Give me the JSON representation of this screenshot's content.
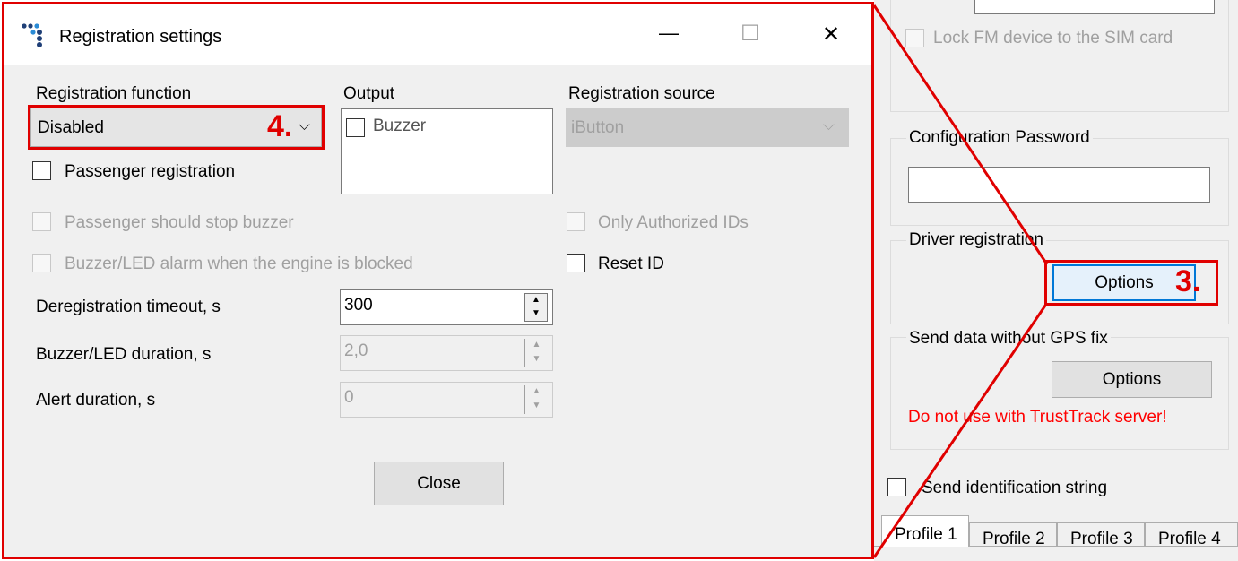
{
  "dialog": {
    "title": "Registration settings",
    "title_buttons": {
      "minimize": "—",
      "maximize": "☐",
      "close": "✕"
    },
    "registration_function": {
      "label": "Registration function",
      "value": "Disabled",
      "callout": "4."
    },
    "output": {
      "label": "Output",
      "items": [
        {
          "label": "Buzzer",
          "checked": false
        }
      ]
    },
    "registration_source": {
      "label": "Registration source",
      "value": "iButton"
    },
    "checkboxes": {
      "passenger_registration": "Passenger registration",
      "passenger_stop_buzzer": "Passenger should stop buzzer",
      "buzzer_led_alarm": "Buzzer/LED alarm when the engine is blocked",
      "only_authorized_ids": "Only Authorized IDs",
      "reset_id": "Reset ID"
    },
    "fields": {
      "deregistration_timeout": {
        "label": "Deregistration timeout, s",
        "value": "300"
      },
      "buzzer_led_duration": {
        "label": "Buzzer/LED duration, s",
        "value": "2,0"
      },
      "alert_duration": {
        "label": "Alert duration, s",
        "value": "0"
      }
    },
    "close_button": "Close"
  },
  "background": {
    "lock_fm_device": "Lock FM device to the SIM card",
    "configuration_password": {
      "label": "Configuration Password",
      "value": ""
    },
    "driver_registration": {
      "label": "Driver registration",
      "button": "Options",
      "callout": "3."
    },
    "send_data_without_gps": {
      "label": "Send data without GPS fix",
      "button": "Options",
      "warning": "Do not use with TrustTrack server!"
    },
    "send_identification_string": "Send identification string",
    "profile_tabs": [
      "Profile 1",
      "Profile 2",
      "Profile 3",
      "Profile 4"
    ]
  },
  "colors": {
    "highlight": "#e00000",
    "warning": "#ff0000",
    "focus": "#0078d7"
  }
}
